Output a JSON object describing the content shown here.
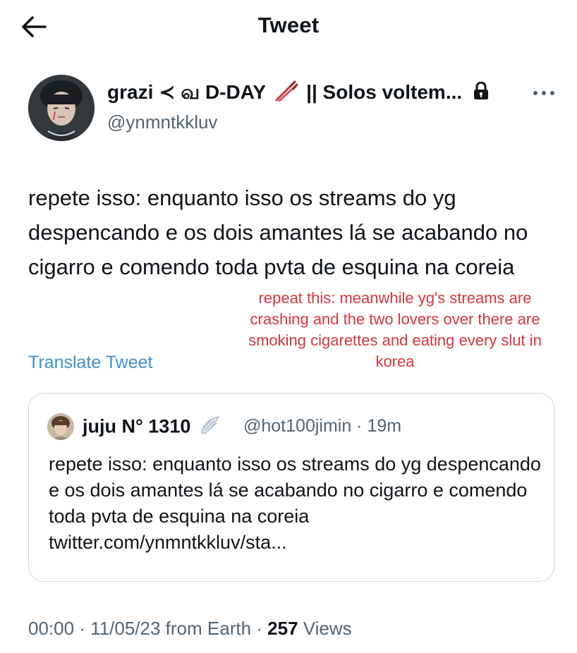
{
  "header": {
    "title": "Tweet"
  },
  "author": {
    "display_name_part1": "grazi ≺ வ D-DAY",
    "display_name_part2": "|| Solos voltem...",
    "username": "@ynmntkkluv"
  },
  "tweet": {
    "text": "repete isso: enquanto isso os streams do yg despencando e os dois amantes lá se acabando no cigarro e comendo toda pvta de esquina na coreia",
    "translate_label": "Translate Tweet"
  },
  "overlay": {
    "translation": "repeat this: meanwhile yg's streams are crashing and the two lovers over there are smoking cigarettes and eating every slut in korea",
    "color": "#d6363f"
  },
  "quote": {
    "display_name": "juju N° 1310",
    "handle_time": "@hot100jimin · 19m",
    "text": "repete isso: enquanto isso os streams do yg despencando e os dois amantes lá se acabando no cigarro e comendo toda pvta de esquina na coreia twitter.com/ynmntkkluv/sta..."
  },
  "meta": {
    "time_date_source": "00:00 · 11/05/23 from Earth · ",
    "views_count": "257",
    "views_label": " Views"
  },
  "icons": {
    "back": "arrow-left-icon",
    "more": "ellipsis-icon",
    "lock": "lock-icon",
    "chopsticks": "chopsticks-icon",
    "wing": "wing-icon"
  },
  "colors": {
    "link": "#3f91cf",
    "secondary_text": "#536471",
    "primary_text": "#0f1419",
    "border": "#cfd9de"
  }
}
